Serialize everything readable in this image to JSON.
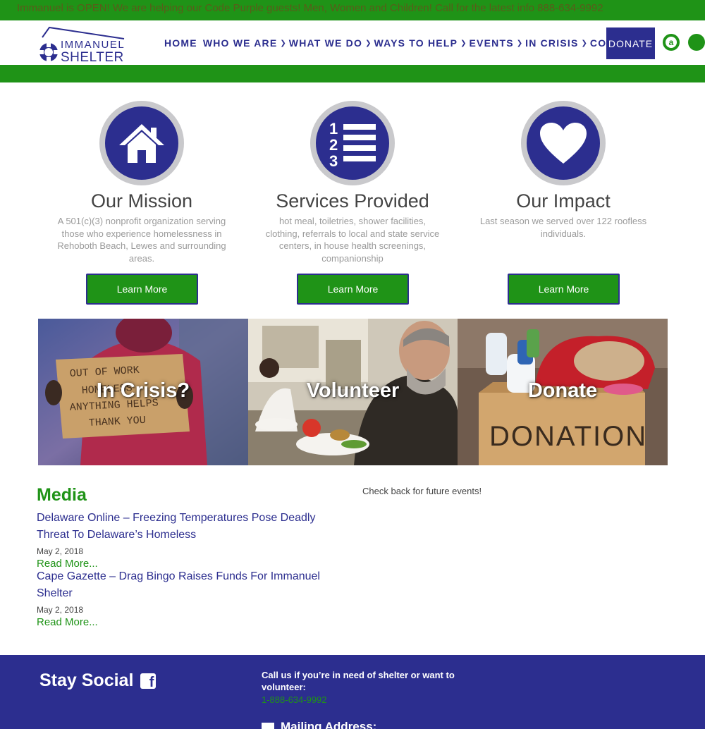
{
  "announcement": "Immanuel is OPEN! We are helping our Code Purple guests! Men, Women and Children! Call for the latest info 888-634-9992",
  "logo": {
    "line1": "IMMANUEL",
    "line2": "SHELTER"
  },
  "nav": {
    "home": "HOME",
    "who_we_are": "WHO WE ARE",
    "what_we_do": "WHAT WE DO",
    "ways_to_help": "WAYS TO HELP",
    "events": "EVENTS",
    "in_crisis": "IN CRISIS",
    "contact": "CONTACT",
    "donate": "DONATE",
    "separator": "❯",
    "amazon_icon": "a"
  },
  "features": [
    {
      "icon": "house-icon",
      "title": "Our Mission",
      "text": "A 501(c)(3) nonprofit organization serving those who experience homelessness in Rehoboth Beach, Lewes and surrounding areas.",
      "button": "Learn More"
    },
    {
      "icon": "numbered-list-icon",
      "title": "Services Provided",
      "text": "hot meal, toiletries, shower facilities, clothing, referrals to local and state service centers, in house health screenings, companionship",
      "button": "Learn More"
    },
    {
      "icon": "heart-icon",
      "title": "Our Impact",
      "text": "Last season we served over 122 roofless individuals.",
      "button": "Learn More"
    }
  ],
  "tiles": [
    {
      "label": "In Crisis?",
      "sign_lines": [
        "OUT OF WORK",
        "HOMELESS",
        "ANYTHING HELPS",
        "THANK YOU"
      ]
    },
    {
      "label": "Volunteer"
    },
    {
      "label": "Donate",
      "box_text": "DONATION"
    }
  ],
  "media": {
    "title": "Media",
    "articles": [
      {
        "title": "Delaware Online – Freezing Temperatures Pose Deadly Threat To Delaware’s Homeless",
        "date": "May 2, 2018",
        "more": "Read More..."
      },
      {
        "title": "Cape Gazette – Drag Bingo Raises Funds For Immanuel Shelter",
        "date": "May 2, 2018",
        "more": "Read More..."
      }
    ]
  },
  "events_note": "Check back for future events!",
  "footer": {
    "stay_social": "Stay Social",
    "call_text": "Call us if you’re in need of shelter or want to volunteer:",
    "phone": "1-888-634-9992",
    "mailing": "Mailing Address:"
  },
  "colors": {
    "green": "#1f9317",
    "navy": "#2c2e8f",
    "grey_ring": "#c9c9cc"
  }
}
